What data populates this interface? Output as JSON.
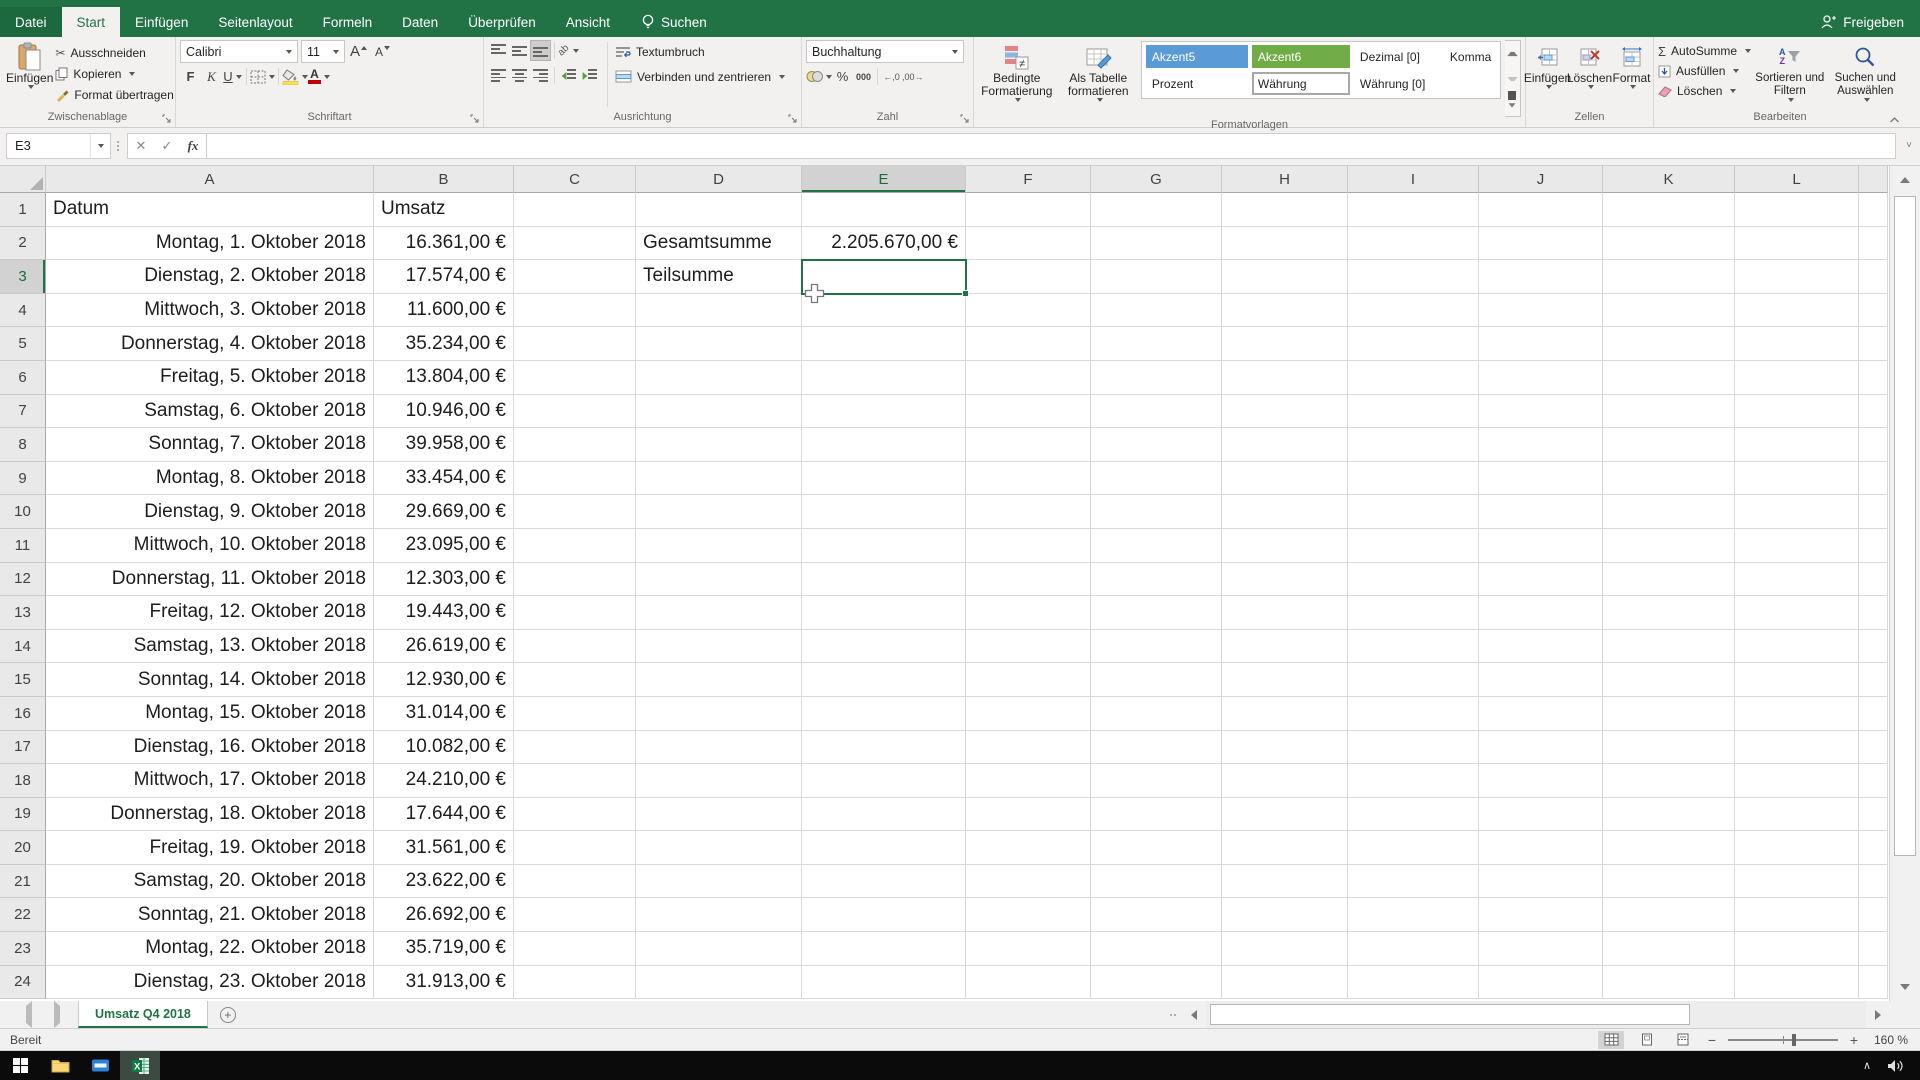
{
  "tabs": {
    "file": "Datei",
    "items": [
      "Start",
      "Einfügen",
      "Seitenlayout",
      "Formeln",
      "Daten",
      "Überprüfen",
      "Ansicht"
    ],
    "active": "Start",
    "search": "Suchen",
    "share": "Freigeben"
  },
  "ribbon": {
    "clipboard": {
      "paste": "Einfügen",
      "cut": "Ausschneiden",
      "copy": "Kopieren",
      "format_painter": "Format übertragen",
      "label": "Zwischenablage"
    },
    "font": {
      "name": "Calibri",
      "size": "11",
      "bold": "F",
      "italic": "K",
      "underline": "U",
      "label": "Schriftart"
    },
    "alignment": {
      "wrap": "Textumbruch",
      "merge": "Verbinden und zentrieren",
      "label": "Ausrichtung"
    },
    "number": {
      "format": "Buchhaltung",
      "percent": "%",
      "thousand": "000",
      "label": "Zahl"
    },
    "styles": {
      "conditional": "Bedingte Formatierung",
      "as_table": "Als Tabelle formatieren",
      "label": "Formatvorlagen",
      "gallery": [
        {
          "label": "Akzent5",
          "type": "accent5"
        },
        {
          "label": "Akzent6",
          "type": "accent6"
        },
        {
          "label": "Dezimal [0]",
          "type": "plain"
        },
        {
          "label": "Komma",
          "type": "plain"
        },
        {
          "label": "Prozent",
          "type": "plain"
        },
        {
          "label": "Währung",
          "type": "selected"
        },
        {
          "label": "Währung [0]",
          "type": "plain"
        },
        {
          "label": "",
          "type": "empty"
        }
      ]
    },
    "cells": {
      "insert": "Einfügen",
      "delete": "Löschen",
      "format": "Format",
      "label": "Zellen"
    },
    "editing": {
      "autosum": "AutoSumme",
      "fill": "Ausfüllen",
      "clear": "Löschen",
      "sort": "Sortieren und Filtern",
      "find": "Suchen und Auswählen",
      "label": "Bearbeiten"
    }
  },
  "formula_bar": {
    "name_box": "E3",
    "fx": "fx",
    "formula": ""
  },
  "grid": {
    "columns": [
      "A",
      "B",
      "C",
      "D",
      "E",
      "F",
      "G",
      "H",
      "I",
      "J",
      "K",
      "L"
    ],
    "selected_column": "E",
    "selected_row": 3,
    "header_a": "Datum",
    "header_b": "Umsatz",
    "summary": {
      "total_label": "Gesamtsumme",
      "total_value": "2.205.670,00 €",
      "subtotal_label": "Teilsumme"
    },
    "data_rows": [
      {
        "date": "Montag, 1. Oktober 2018",
        "value": "16.361,00 €"
      },
      {
        "date": "Dienstag, 2. Oktober 2018",
        "value": "17.574,00 €"
      },
      {
        "date": "Mittwoch, 3. Oktober 2018",
        "value": "11.600,00 €"
      },
      {
        "date": "Donnerstag, 4. Oktober 2018",
        "value": "35.234,00 €"
      },
      {
        "date": "Freitag, 5. Oktober 2018",
        "value": "13.804,00 €"
      },
      {
        "date": "Samstag, 6. Oktober 2018",
        "value": "10.946,00 €"
      },
      {
        "date": "Sonntag, 7. Oktober 2018",
        "value": "39.958,00 €"
      },
      {
        "date": "Montag, 8. Oktober 2018",
        "value": "33.454,00 €"
      },
      {
        "date": "Dienstag, 9. Oktober 2018",
        "value": "29.669,00 €"
      },
      {
        "date": "Mittwoch, 10. Oktober 2018",
        "value": "23.095,00 €"
      },
      {
        "date": "Donnerstag, 11. Oktober 2018",
        "value": "12.303,00 €"
      },
      {
        "date": "Freitag, 12. Oktober 2018",
        "value": "19.443,00 €"
      },
      {
        "date": "Samstag, 13. Oktober 2018",
        "value": "26.619,00 €"
      },
      {
        "date": "Sonntag, 14. Oktober 2018",
        "value": "12.930,00 €"
      },
      {
        "date": "Montag, 15. Oktober 2018",
        "value": "31.014,00 €"
      },
      {
        "date": "Dienstag, 16. Oktober 2018",
        "value": "10.082,00 €"
      },
      {
        "date": "Mittwoch, 17. Oktober 2018",
        "value": "24.210,00 €"
      },
      {
        "date": "Donnerstag, 18. Oktober 2018",
        "value": "17.644,00 €"
      },
      {
        "date": "Freitag, 19. Oktober 2018",
        "value": "31.561,00 €"
      },
      {
        "date": "Samstag, 20. Oktober 2018",
        "value": "23.622,00 €"
      },
      {
        "date": "Sonntag, 21. Oktober 2018",
        "value": "26.692,00 €"
      },
      {
        "date": "Montag, 22. Oktober 2018",
        "value": "35.719,00 €"
      },
      {
        "date": "Dienstag, 23. Oktober 2018",
        "value": "31.913,00 €"
      }
    ]
  },
  "sheet_bar": {
    "tab": "Umsatz Q4 2018"
  },
  "status_bar": {
    "ready": "Bereit",
    "zoom": "160 %"
  },
  "colors": {
    "excel_green": "#217346",
    "accent5": "#5b9bd5",
    "accent6": "#70ad47"
  }
}
